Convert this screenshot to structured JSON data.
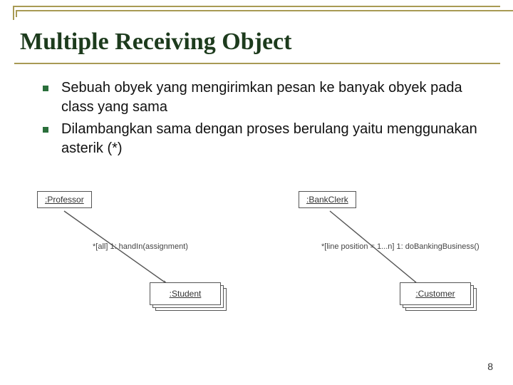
{
  "title": "Multiple Receiving Object",
  "bullets": [
    "Sebuah obyek yang mengirimkan pesan ke banyak obyek pada class yang sama",
    "Dilambangkan sama dengan proses berulang yaitu menggunakan asterik (*)"
  ],
  "diagram_left": {
    "sender": ":Professor",
    "message": "*[all] 1: handIn(assignment)",
    "receiver": ":Student"
  },
  "diagram_right": {
    "sender": ":BankClerk",
    "message": "*[line position = 1...n] 1: doBankingBusiness()",
    "receiver": ":Customer"
  },
  "page_number": "8"
}
